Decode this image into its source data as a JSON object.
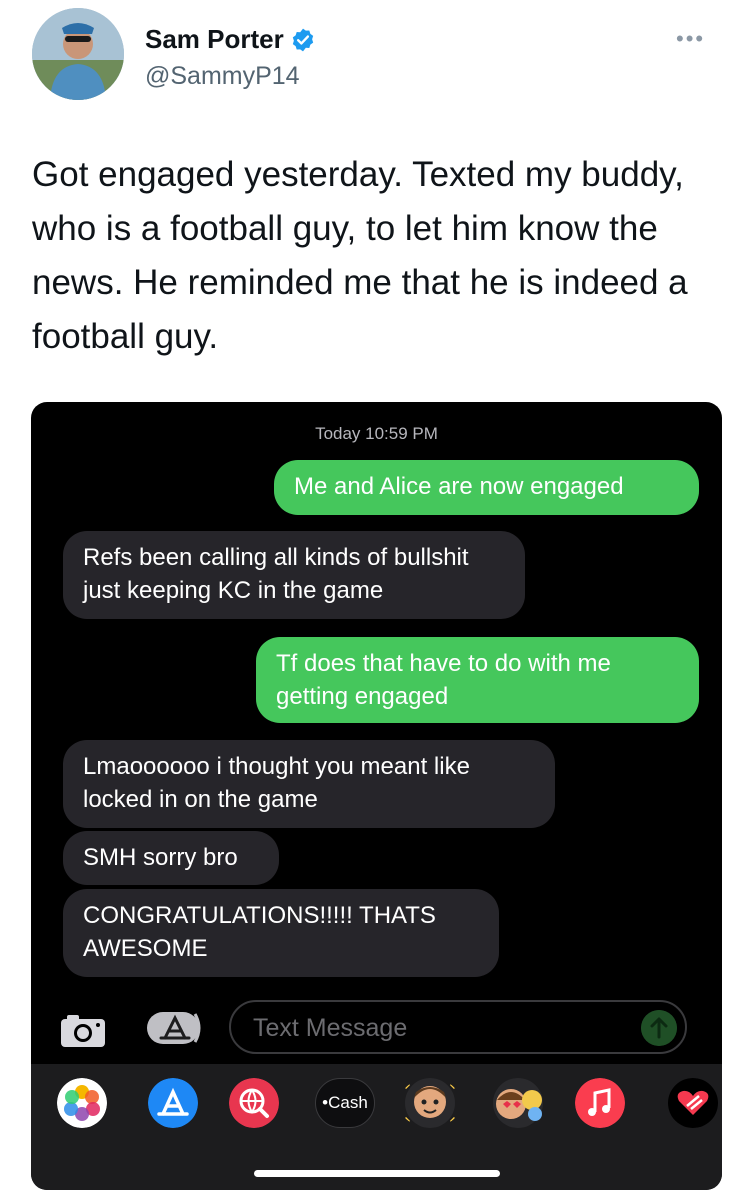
{
  "tweet": {
    "display_name": "Sam Porter",
    "handle": "@SammyP14",
    "more": "•••",
    "text": "Got engaged yesterday. Texted my buddy, who is a football guy, to let him know the news. He reminded me that he is indeed a football guy."
  },
  "conversation": {
    "timestamp": "Today 10:59 PM",
    "messages": [
      {
        "direction": "outgoing",
        "text": "Me and Alice are now engaged"
      },
      {
        "direction": "incoming",
        "text": "Refs been calling all kinds of bullshit just keeping KC in the game"
      },
      {
        "direction": "outgoing",
        "text": "Tf does that have to do with me getting engaged"
      },
      {
        "direction": "incoming",
        "text": "Lmaoooooo i thought you meant like locked in on the game"
      },
      {
        "direction": "incoming",
        "text": "SMH sorry bro"
      },
      {
        "direction": "incoming",
        "text": "CONGRATULATIONS!!!!! THATS AWESOME"
      }
    ]
  },
  "composer": {
    "placeholder": "Text Message",
    "camera_icon": "camera-icon",
    "apps_icon": "app-store-icon",
    "send_icon": "send-arrow-icon"
  },
  "app_drawer": {
    "apps": [
      {
        "icon": "photos-icon"
      },
      {
        "icon": "app-store-icon"
      },
      {
        "icon": "web-search-icon"
      },
      {
        "icon": "apple-cash-icon",
        "label": "Cash"
      },
      {
        "icon": "memoji-icon"
      },
      {
        "icon": "memoji-stickers-icon"
      },
      {
        "icon": "music-icon"
      },
      {
        "icon": "digital-touch-icon"
      }
    ]
  },
  "colors": {
    "outgoing_bubble": "#45c75c",
    "incoming_bubble": "#26252a",
    "verified_badge": "#1d9bf0",
    "background": "#000000"
  }
}
